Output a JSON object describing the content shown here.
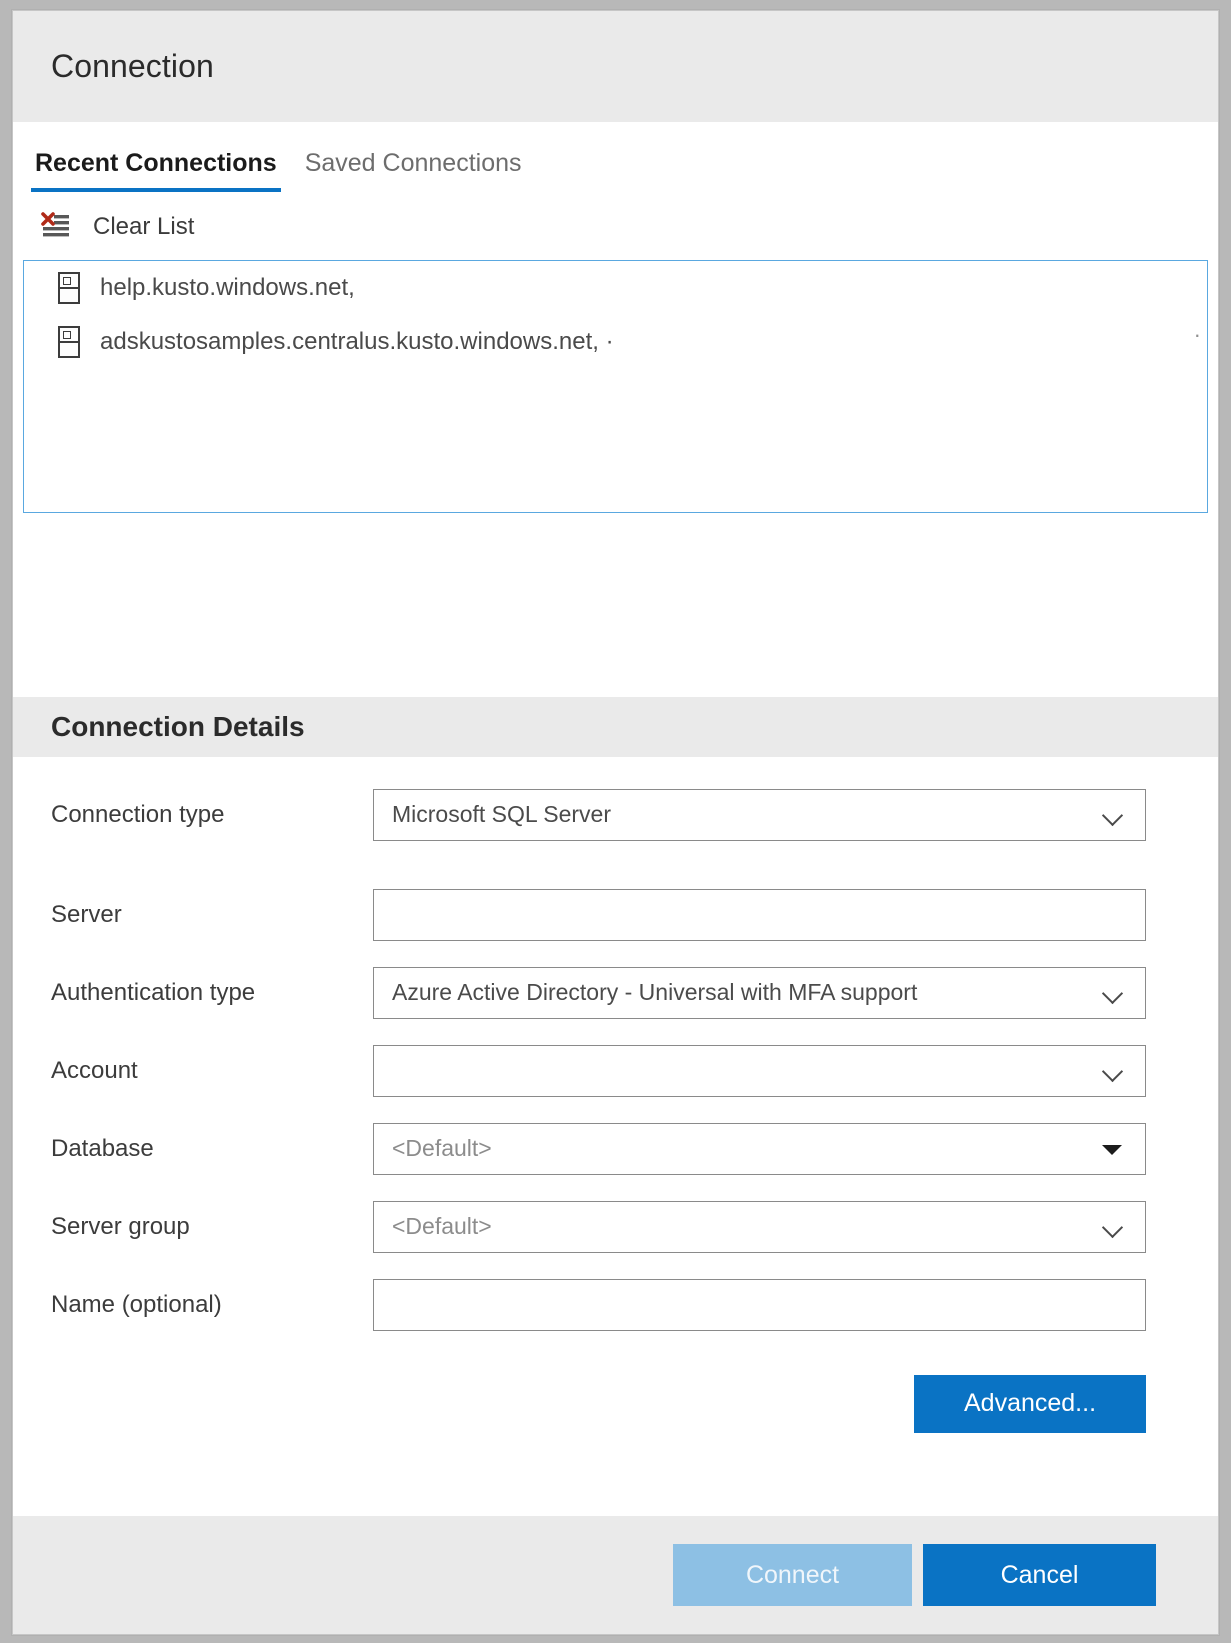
{
  "window": {
    "title": "Connection"
  },
  "tabs": [
    {
      "label": "Recent Connections",
      "active": true
    },
    {
      "label": "Saved Connections",
      "active": false
    }
  ],
  "toolbar": {
    "clear_list_label": "Clear List",
    "clear_list_icon": "clear-list-icon"
  },
  "recent_connections": {
    "items": [
      {
        "label": "help.kusto.windows.net,",
        "icon": "server-icon"
      },
      {
        "label": "adskustosamples.centralus.kusto.windows.net, ·",
        "icon": "server-icon"
      }
    ],
    "trailing_marker": "·"
  },
  "details": {
    "header": "Connection Details",
    "fields": [
      {
        "label": "Connection type",
        "value": "Microsoft SQL Server",
        "control": "dropdown",
        "icon": "chevron-down-icon",
        "is_placeholder": false
      },
      {
        "label": "Server",
        "value": "",
        "control": "text",
        "icon": "",
        "is_placeholder": false
      },
      {
        "label": "Authentication type",
        "value": "Azure Active Directory - Universal with MFA support",
        "control": "dropdown",
        "icon": "chevron-down-icon",
        "is_placeholder": false
      },
      {
        "label": "Account",
        "value": "",
        "control": "dropdown",
        "icon": "chevron-down-icon",
        "is_placeholder": false
      },
      {
        "label": "Database",
        "value": "<Default>",
        "control": "combobox",
        "icon": "triangle-down-icon",
        "is_placeholder": true
      },
      {
        "label": "Server group",
        "value": "<Default>",
        "control": "dropdown",
        "icon": "chevron-down-icon",
        "is_placeholder": true
      },
      {
        "label": "Name (optional)",
        "value": "",
        "control": "text",
        "icon": "",
        "is_placeholder": false
      }
    ],
    "advanced_label": "Advanced..."
  },
  "footer": {
    "connect_label": "Connect",
    "cancel_label": "Cancel"
  },
  "colors": {
    "accent": "#0a73c4",
    "accent_disabled": "#8dc0e4",
    "tab_underline": "#0a73c4",
    "header_bg": "#eaeaea",
    "list_border": "#5aa8e0",
    "clear_icon_red": "#b02a18"
  }
}
